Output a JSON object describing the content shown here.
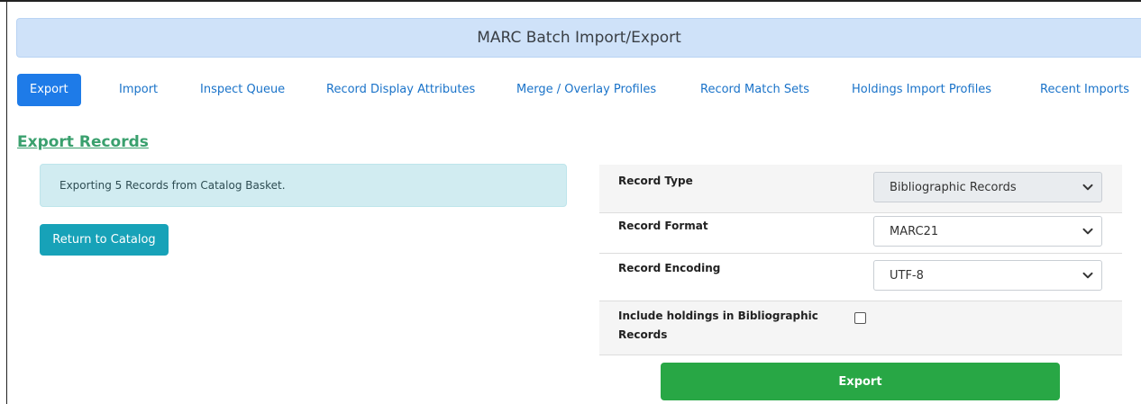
{
  "header": {
    "title": "MARC Batch Import/Export"
  },
  "tabs": [
    {
      "label": "Export",
      "active": true
    },
    {
      "label": "Import"
    },
    {
      "label": "Inspect Queue"
    },
    {
      "label": "Record Display Attributes"
    },
    {
      "label": "Merge / Overlay Profiles"
    },
    {
      "label": "Record Match Sets"
    },
    {
      "label": "Holdings Import Profiles"
    },
    {
      "label": "Recent Imports"
    }
  ],
  "section": {
    "title": "Export Records"
  },
  "alert": {
    "message": "Exporting 5 Records from Catalog Basket."
  },
  "return_button": {
    "label": "Return to Catalog"
  },
  "form": {
    "record_type": {
      "label": "Record Type",
      "value": "Bibliographic Records",
      "disabled": true
    },
    "record_format": {
      "label": "Record Format",
      "value": "MARC21"
    },
    "record_encoding": {
      "label": "Record Encoding",
      "value": "UTF-8"
    },
    "include_holdings": {
      "label_line1": "Include holdings in Bibliographic",
      "label_line2": "Records",
      "checked": false
    }
  },
  "export_button": {
    "label": "Export"
  },
  "colors": {
    "primary": "#1e7be8",
    "success": "#28a745",
    "info": "#17a2b8",
    "heading": "#3aa06e",
    "banner": "#cfe2f9"
  },
  "icons": {
    "select_chevron": "chevron-down-icon"
  }
}
